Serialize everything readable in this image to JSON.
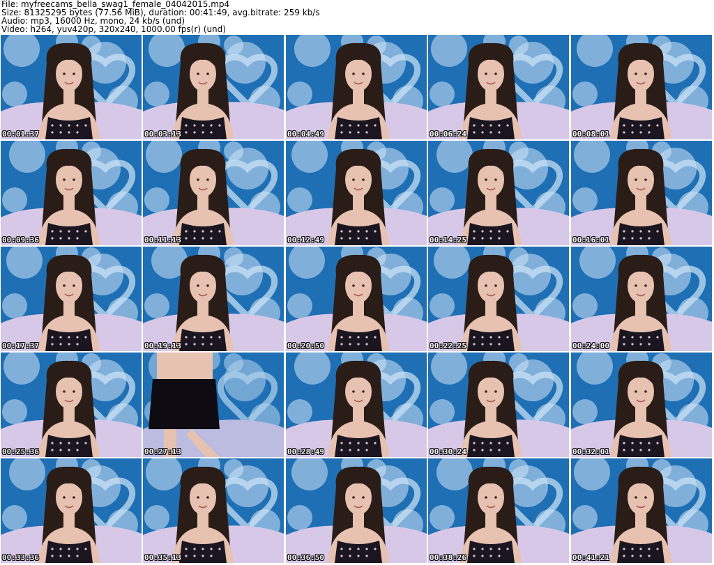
{
  "header": {
    "file_line": "File: myfreecams_bella_swag1_female_04042015.mp4",
    "size_line": "Size: 81325295 bytes (77.56 MiB), duration: 00:41:49, avg.bitrate: 259 kb/s",
    "audio_line": "Audio: mp3, 16000 Hz, mono, 24 kb/s (und)",
    "video_line": "Video: h264, yuv420p, 320x240, 1000.00 fps(r) (und)"
  },
  "colors": {
    "backdrop_blue": "#1f6fb4",
    "backdrop_light": "#cfe6f7",
    "sheet": "#d7c8e8",
    "hair": "#2a1c16",
    "skin": "#e7c2b0",
    "top": "#1b1520"
  },
  "thumbnails": [
    {
      "timestamp": "00:01:37",
      "scene": "portrait"
    },
    {
      "timestamp": "00:03:13",
      "scene": "portrait"
    },
    {
      "timestamp": "00:04:49",
      "scene": "portrait"
    },
    {
      "timestamp": "00:06:24",
      "scene": "portrait"
    },
    {
      "timestamp": "00:08:01",
      "scene": "portrait"
    },
    {
      "timestamp": "00:09:36",
      "scene": "portrait"
    },
    {
      "timestamp": "00:11:13",
      "scene": "portrait"
    },
    {
      "timestamp": "00:12:49",
      "scene": "portrait"
    },
    {
      "timestamp": "00:14:25",
      "scene": "portrait"
    },
    {
      "timestamp": "00:16:01",
      "scene": "portrait"
    },
    {
      "timestamp": "00:17:37",
      "scene": "portrait"
    },
    {
      "timestamp": "00:19:13",
      "scene": "portrait"
    },
    {
      "timestamp": "00:20:50",
      "scene": "portrait"
    },
    {
      "timestamp": "00:22:25",
      "scene": "portrait"
    },
    {
      "timestamp": "00:24:00",
      "scene": "portrait"
    },
    {
      "timestamp": "00:25:36",
      "scene": "portrait"
    },
    {
      "timestamp": "00:27:13",
      "scene": "standing"
    },
    {
      "timestamp": "00:28:49",
      "scene": "portrait"
    },
    {
      "timestamp": "00:30:24",
      "scene": "portrait"
    },
    {
      "timestamp": "00:32:01",
      "scene": "portrait"
    },
    {
      "timestamp": "00:33:36",
      "scene": "portrait"
    },
    {
      "timestamp": "00:35:13",
      "scene": "portrait"
    },
    {
      "timestamp": "00:36:50",
      "scene": "portrait"
    },
    {
      "timestamp": "00:38:26",
      "scene": "portrait"
    },
    {
      "timestamp": "00:41:21",
      "scene": "portrait"
    }
  ]
}
